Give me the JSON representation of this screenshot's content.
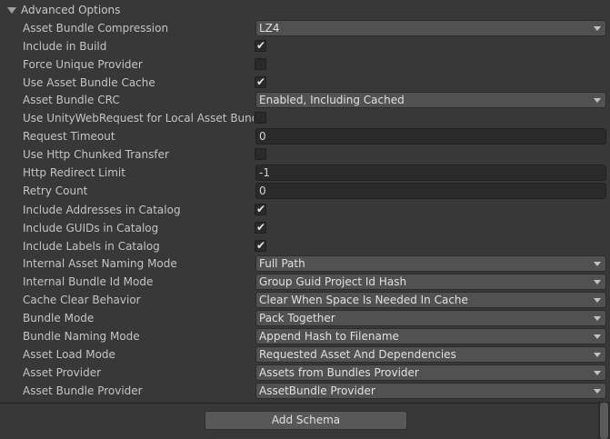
{
  "section": {
    "title": "Advanced Options",
    "add_schema_label": "Add Schema"
  },
  "fields": {
    "asset_bundle_compression": {
      "label": "Asset Bundle Compression",
      "value": "LZ4"
    },
    "include_in_build": {
      "label": "Include in Build",
      "checked": true,
      "check_glyph": "✔"
    },
    "force_unique_provider": {
      "label": "Force Unique Provider",
      "checked": false
    },
    "use_asset_bundle_cache": {
      "label": "Use Asset Bundle Cache",
      "checked": true,
      "check_glyph": "✔"
    },
    "asset_bundle_crc": {
      "label": "Asset Bundle CRC",
      "value": "Enabled, Including Cached"
    },
    "use_unitywebrequest_local": {
      "label": "Use UnityWebRequest for Local Asset Bundles",
      "checked": false
    },
    "request_timeout": {
      "label": "Request Timeout",
      "value": "0"
    },
    "use_http_chunked_transfer": {
      "label": "Use Http Chunked Transfer",
      "checked": false
    },
    "http_redirect_limit": {
      "label": "Http Redirect Limit",
      "value": "-1"
    },
    "retry_count": {
      "label": "Retry Count",
      "value": "0"
    },
    "include_addresses_in_catalog": {
      "label": "Include Addresses in Catalog",
      "checked": true,
      "check_glyph": "✔"
    },
    "include_guids_in_catalog": {
      "label": "Include GUIDs in Catalog",
      "checked": true,
      "check_glyph": "✔"
    },
    "include_labels_in_catalog": {
      "label": "Include Labels in Catalog",
      "checked": true,
      "check_glyph": "✔"
    },
    "internal_asset_naming_mode": {
      "label": "Internal Asset Naming Mode",
      "value": "Full Path"
    },
    "internal_bundle_id_mode": {
      "label": "Internal Bundle Id Mode",
      "value": "Group Guid Project Id Hash"
    },
    "cache_clear_behavior": {
      "label": "Cache Clear Behavior",
      "value": "Clear When Space Is Needed In Cache"
    },
    "bundle_mode": {
      "label": "Bundle Mode",
      "value": "Pack Together"
    },
    "bundle_naming_mode": {
      "label": "Bundle Naming Mode",
      "value": "Append Hash to Filename"
    },
    "asset_load_mode": {
      "label": "Asset Load Mode",
      "value": "Requested Asset And Dependencies"
    },
    "asset_provider": {
      "label": "Asset Provider",
      "value": "Assets from Bundles Provider"
    },
    "asset_bundle_provider": {
      "label": "Asset Bundle Provider",
      "value": "AssetBundle Provider"
    }
  },
  "colors": {
    "background": "#383838",
    "dropdown": "#515151",
    "textfield": "#2a2a2a",
    "text": "#c4c4c4"
  }
}
